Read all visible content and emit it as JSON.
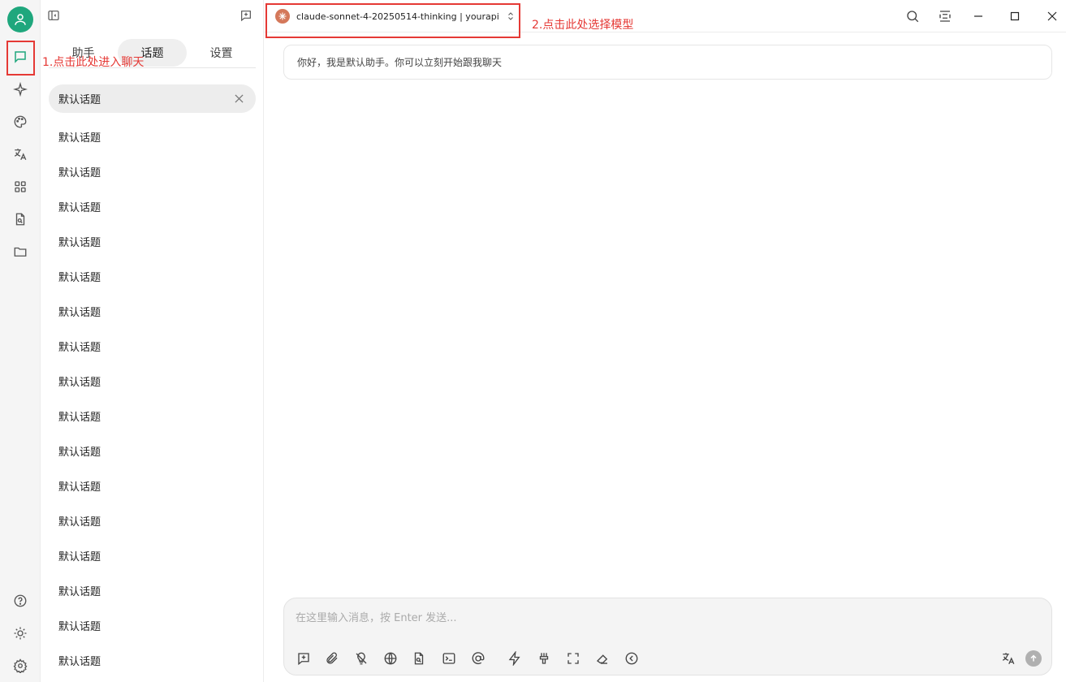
{
  "rail": {
    "items": [
      {
        "name": "chat",
        "icon": "chat-bubble-icon"
      },
      {
        "name": "agents",
        "icon": "sparkle-icon"
      },
      {
        "name": "paintings",
        "icon": "palette-icon"
      },
      {
        "name": "translate",
        "icon": "translate-icon"
      },
      {
        "name": "apps",
        "icon": "grid-icon"
      },
      {
        "name": "knowledge",
        "icon": "file-search-icon"
      },
      {
        "name": "files",
        "icon": "folder-icon"
      }
    ],
    "bottom": [
      {
        "name": "help",
        "icon": "help-circle-icon"
      },
      {
        "name": "theme",
        "icon": "theme-icon"
      },
      {
        "name": "settings",
        "icon": "gear-icon"
      }
    ]
  },
  "tabs": [
    {
      "label": "助手"
    },
    {
      "label": "话题"
    },
    {
      "label": "设置"
    }
  ],
  "active_tab": 1,
  "topics": [
    "默认话题",
    "默认话题",
    "默认话题",
    "默认话题",
    "默认话题",
    "默认话题",
    "默认话题",
    "默认话题",
    "默认话题",
    "默认话题",
    "默认话题",
    "默认话题",
    "默认话题",
    "默认话题",
    "默认话题",
    "默认话题",
    "默认话题"
  ],
  "model": {
    "label": "claude-sonnet-4-20250514-thinking | yourapi",
    "logo_color": "#d4785a"
  },
  "welcome": "你好，我是默认助手。你可以立刻开始跟我聊天",
  "composer": {
    "placeholder": "在这里输入消息，按 Enter 发送..."
  },
  "annotations": {
    "step1": "1.点击此处进入聊天",
    "step2": "2.点击此处选择模型"
  },
  "colors": {
    "accent": "#1fa77d",
    "annotation": "#e53935"
  }
}
